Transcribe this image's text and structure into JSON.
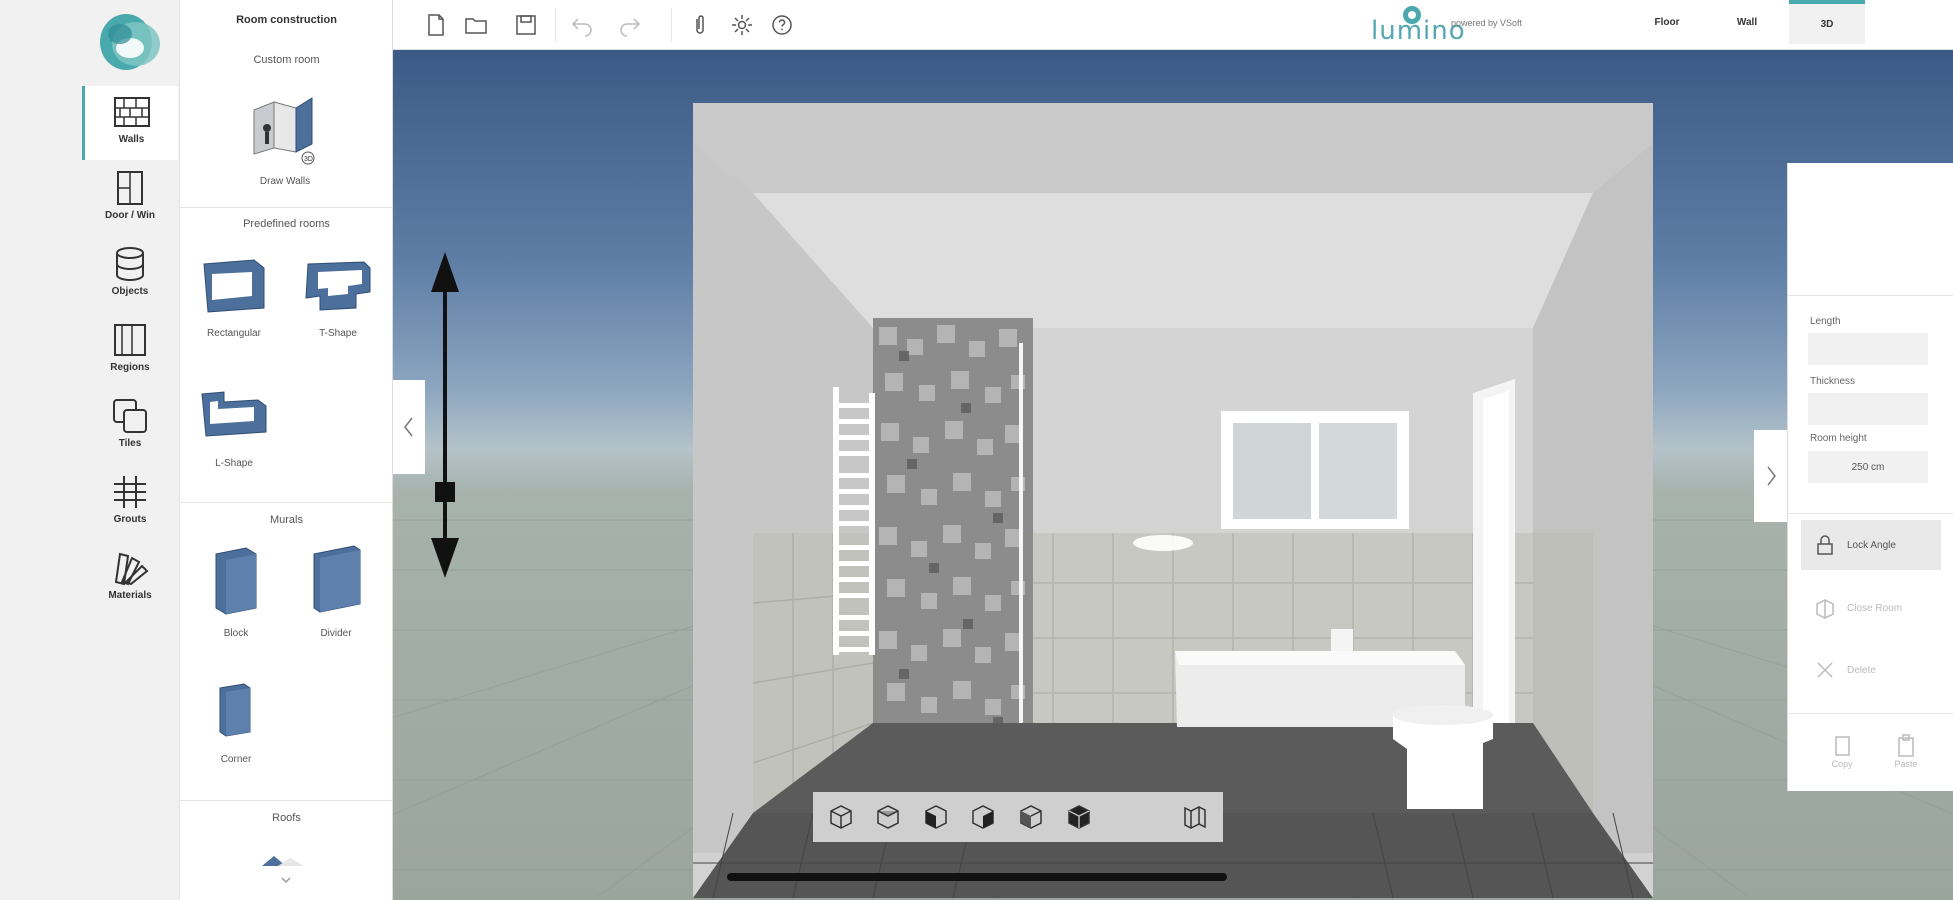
{
  "rail": {
    "items": [
      {
        "label": "Walls",
        "icon": "walls-icon",
        "active": true
      },
      {
        "label": "Door / Win",
        "icon": "door-window-icon"
      },
      {
        "label": "Objects",
        "icon": "objects-icon"
      },
      {
        "label": "Regions",
        "icon": "regions-icon"
      },
      {
        "label": "Tiles",
        "icon": "tiles-icon"
      },
      {
        "label": "Grouts",
        "icon": "grouts-icon"
      },
      {
        "label": "Materials",
        "icon": "materials-icon"
      }
    ]
  },
  "panel": {
    "title": "Room construction",
    "custom_room": "Custom room",
    "draw_walls": "Draw Walls",
    "predefined": "Predefined rooms",
    "rectangular": "Rectangular",
    "t_shape": "T-Shape",
    "l_shape": "L-Shape",
    "murals": "Murals",
    "block": "Block",
    "divider": "Divider",
    "corner": "Corner",
    "roofs": "Roofs"
  },
  "topbar": {
    "brand": "lumino",
    "powered": "powered by VSoft",
    "views": [
      "Floor",
      "Wall",
      "3D"
    ],
    "active_view": "3D"
  },
  "props": {
    "length_label": "Length",
    "thickness_label": "Thickness",
    "room_height_label": "Room height",
    "room_height_value": "250 cm",
    "lock_angle": "Lock Angle",
    "close_room": "Close Room",
    "delete": "Delete",
    "copy": "Copy",
    "paste": "Paste"
  },
  "colors": {
    "accent": "#4aa9ad",
    "sky_top": "#3b5a85",
    "floor": "#9aa59d"
  }
}
